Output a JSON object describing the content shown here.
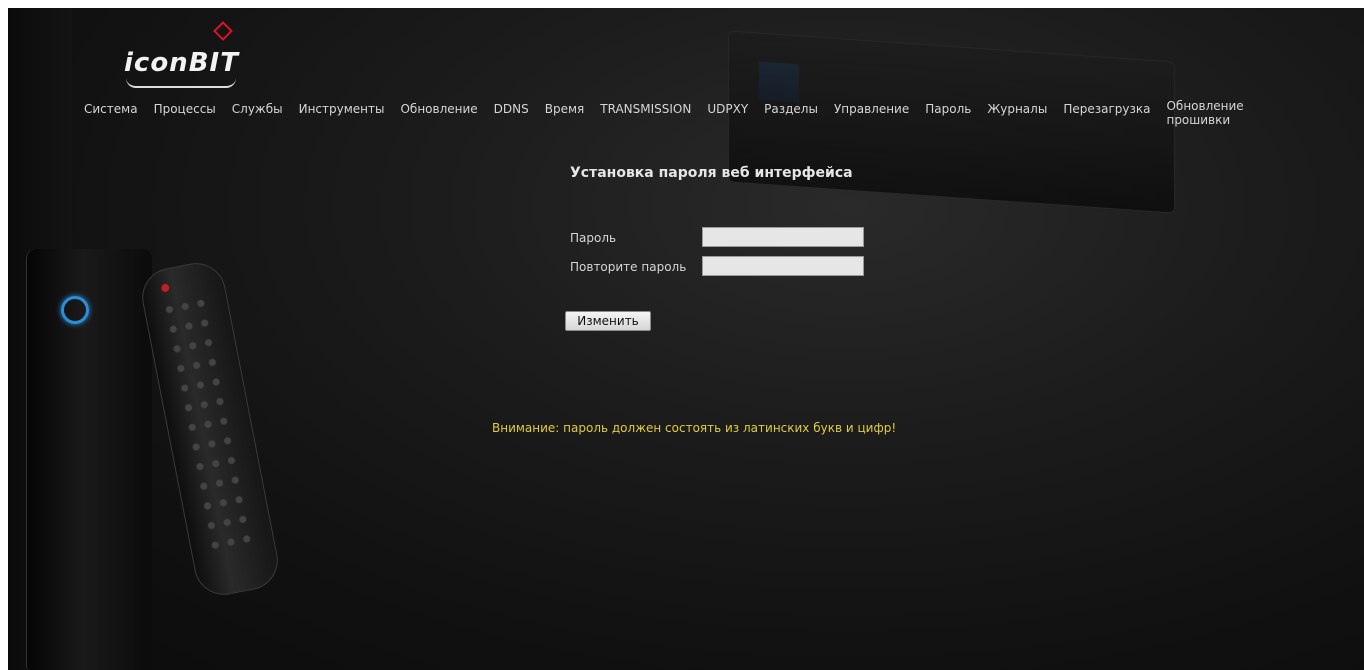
{
  "logo": {
    "text": "iconBIT"
  },
  "nav": {
    "items": [
      {
        "label": "Система"
      },
      {
        "label": "Процессы"
      },
      {
        "label": "Службы"
      },
      {
        "label": "Инструменты"
      },
      {
        "label": "Обновление"
      },
      {
        "label": "DDNS"
      },
      {
        "label": "Время"
      },
      {
        "label": "TRANSMISSION"
      },
      {
        "label": "UDPXY"
      },
      {
        "label": "Разделы"
      },
      {
        "label": "Управление"
      },
      {
        "label": "Пароль"
      },
      {
        "label": "Журналы"
      },
      {
        "label": "Перезагрузка"
      }
    ],
    "last_item": {
      "line1": "Обновление",
      "line2": "прошивки"
    }
  },
  "form": {
    "title": "Установка пароля веб интерфейса",
    "password_label": "Пароль",
    "password_value": "",
    "repeat_label": "Повторите пароль",
    "repeat_value": "",
    "submit_label": "Изменить"
  },
  "warning": "Внимание: пароль должен состоять из латинских букв и цифр!",
  "colors": {
    "background": "#161616",
    "text": "#d6d6d6",
    "warning": "#e0cc3c",
    "logo_accent": "#e0102a",
    "tower_ring": "#2a8fd8"
  }
}
